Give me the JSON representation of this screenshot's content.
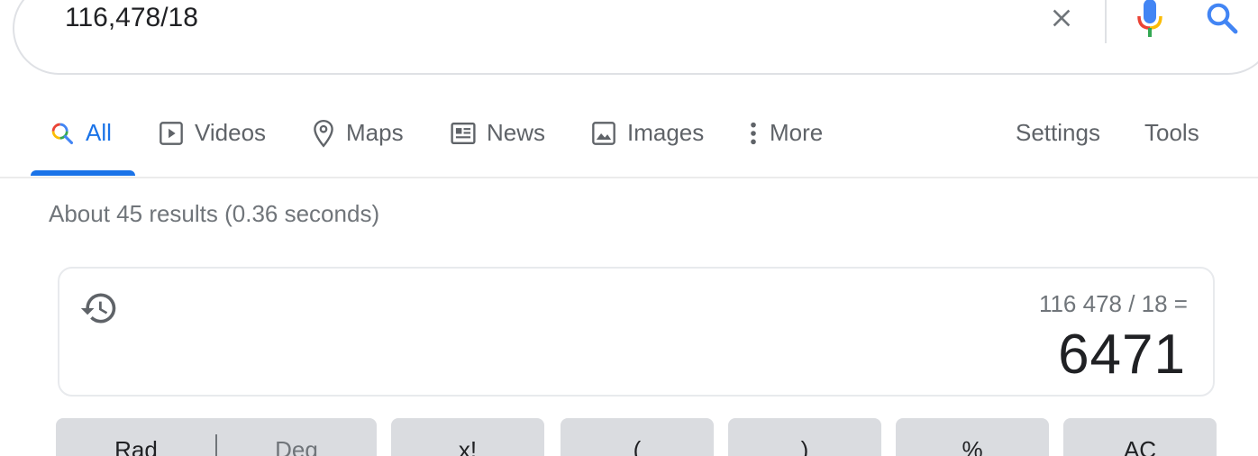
{
  "search": {
    "query": "116,478/18",
    "icons": {
      "clear": "close-icon",
      "voice": "mic-icon",
      "submit": "search-icon"
    }
  },
  "tabs": [
    {
      "label": "All",
      "icon": "search-multicolor-icon",
      "active": true
    },
    {
      "label": "Videos",
      "icon": "play-video-icon"
    },
    {
      "label": "Maps",
      "icon": "map-pin-icon"
    },
    {
      "label": "News",
      "icon": "newspaper-icon"
    },
    {
      "label": "Images",
      "icon": "image-icon"
    },
    {
      "label": "More",
      "icon": "more-vert-icon"
    }
  ],
  "tools": {
    "settings": "Settings",
    "tools": "Tools"
  },
  "stats": "About 45 results (0.36 seconds)",
  "calculator": {
    "expression": "116 478 / 18 =",
    "result": "6471",
    "keys": {
      "rad": "Rad",
      "deg": "Deg",
      "factorial": "x!",
      "open_paren": "(",
      "close_paren": ")",
      "percent": "%",
      "clear": "AC"
    }
  },
  "colors": {
    "accent": "#1a73e8",
    "google_blue": "#4285f4",
    "google_red": "#ea4335",
    "google_yellow": "#fbbc05",
    "google_green": "#34a853",
    "muted_text": "#70757a",
    "key_bg": "#dadce0"
  }
}
